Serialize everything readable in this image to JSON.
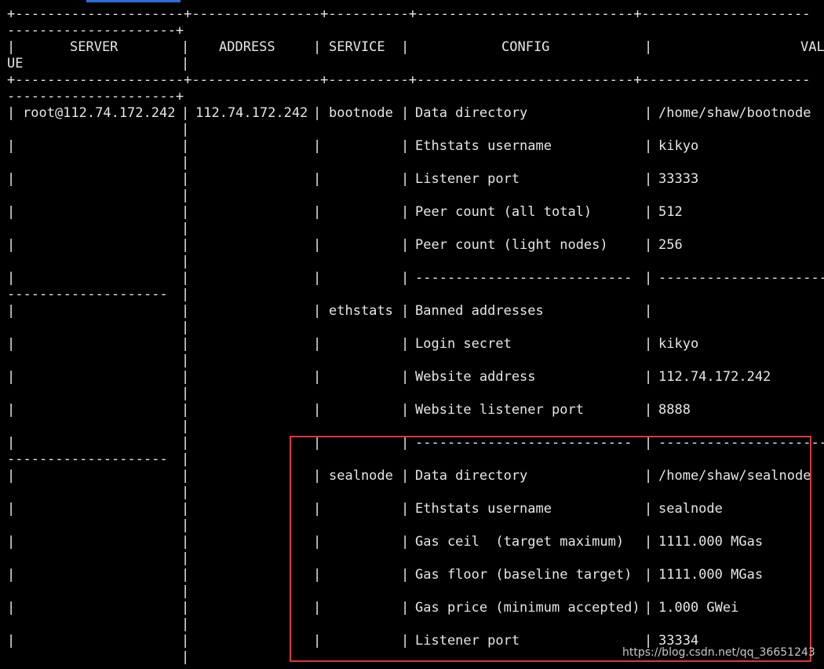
{
  "colors": {
    "background": "#000000",
    "text": "#e6e6e6",
    "highlight_border": "#d93a3a",
    "accent": "#2a6fd6"
  },
  "table": {
    "border_lines": {
      "top_a": "+---------------------+----------------+----------+---------------------------+---------------------",
      "top_b": "---------------------+",
      "sep_a": "+---------------------+----------------+----------+---------------------------+---------------------",
      "sep_b": "---------------------+"
    },
    "header": {
      "server": "SERVER",
      "address": "ADDRESS",
      "service": "SERVICE",
      "config": "CONFIG",
      "value": "VAL",
      "value_wrap": "UE"
    },
    "rows": [
      {
        "server": "root@112.74.172.242",
        "address": "112.74.172.242",
        "service": "bootnode",
        "config": "Data directory",
        "value": "/home/shaw/bootnode"
      },
      {
        "server": "",
        "address": "",
        "service": "",
        "config": "Ethstats username",
        "value": "kikyo"
      },
      {
        "server": "",
        "address": "",
        "service": "",
        "config": "Listener port",
        "value": "33333"
      },
      {
        "server": "",
        "address": "",
        "service": "",
        "config": "Peer count (all total)",
        "value": "512"
      },
      {
        "server": "",
        "address": "",
        "service": "",
        "config": "Peer count (light nodes)",
        "value": "256"
      },
      {
        "server": "",
        "address": "",
        "service": "",
        "config": "---------------------------",
        "value": "---------------------"
      },
      {
        "server": "",
        "address": "",
        "service": "ethstats",
        "config": "Banned addresses",
        "value": ""
      },
      {
        "server": "",
        "address": "",
        "service": "",
        "config": "Login secret",
        "value": "kikyo"
      },
      {
        "server": "",
        "address": "",
        "service": "",
        "config": "Website address",
        "value": "112.74.172.242"
      },
      {
        "server": "",
        "address": "",
        "service": "",
        "config": "Website listener port",
        "value": "8888"
      },
      {
        "server": "",
        "address": "",
        "service": "",
        "config": "---------------------------",
        "value": "---------------------"
      },
      {
        "server": "",
        "address": "",
        "service": "sealnode",
        "config": "Data directory",
        "value": "/home/shaw/sealnode"
      },
      {
        "server": "",
        "address": "",
        "service": "",
        "config": "Ethstats username",
        "value": "sealnode"
      },
      {
        "server": "",
        "address": "",
        "service": "",
        "config": "Gas ceil  (target maximum)",
        "value": "1111.000 MGas"
      },
      {
        "server": "",
        "address": "",
        "service": "",
        "config": "Gas floor (baseline target)",
        "value": "1111.000 MGas"
      },
      {
        "server": "",
        "address": "",
        "service": "",
        "config": "Gas price (minimum accepted)",
        "value": "1.000 GWei"
      },
      {
        "server": "",
        "address": "",
        "service": "",
        "config": "Listener port",
        "value": "33334"
      }
    ],
    "wrap_dash": "--------------------"
  },
  "watermark": "https://blog.csdn.net/qq_36651243"
}
